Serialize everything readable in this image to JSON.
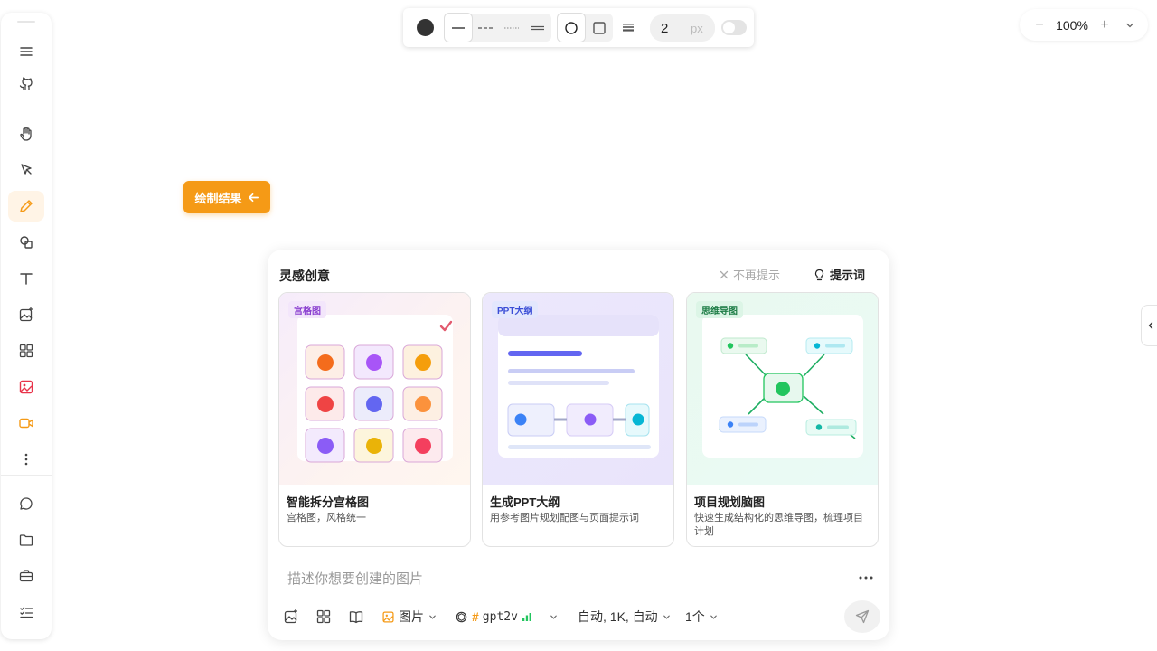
{
  "style_bar": {
    "stroke_color": "#333333",
    "width_value": "2",
    "width_unit": "px"
  },
  "zoom": {
    "minus": "−",
    "value": "100%",
    "plus": "+"
  },
  "result_button": {
    "label": "绘制结果"
  },
  "panel": {
    "title": "灵感创意",
    "dismiss_label": "不再提示",
    "hint_label": "提示词",
    "cards": [
      {
        "tag": "宫格图",
        "title": "智能拆分宫格图",
        "desc": "宫格图，风格统一"
      },
      {
        "tag": "PPT大纲",
        "title": "生成PPT大纲",
        "desc": "用参考图片规划配图与页面提示词"
      },
      {
        "tag": "思维导图",
        "title": "项目规划脑图",
        "desc": "快速生成结构化的思维导图，梳理项目计划"
      }
    ],
    "prompt_placeholder": "描述你想要创建的图片",
    "bottom": {
      "type_label": "图片",
      "model_hash": "#",
      "model_name": "gpt2v",
      "settings_label": "自动, 1K, 自动",
      "count_label": "1个"
    }
  },
  "colors": {
    "accent": "#f59a16",
    "active_tool_bg": "#fff4e6"
  }
}
